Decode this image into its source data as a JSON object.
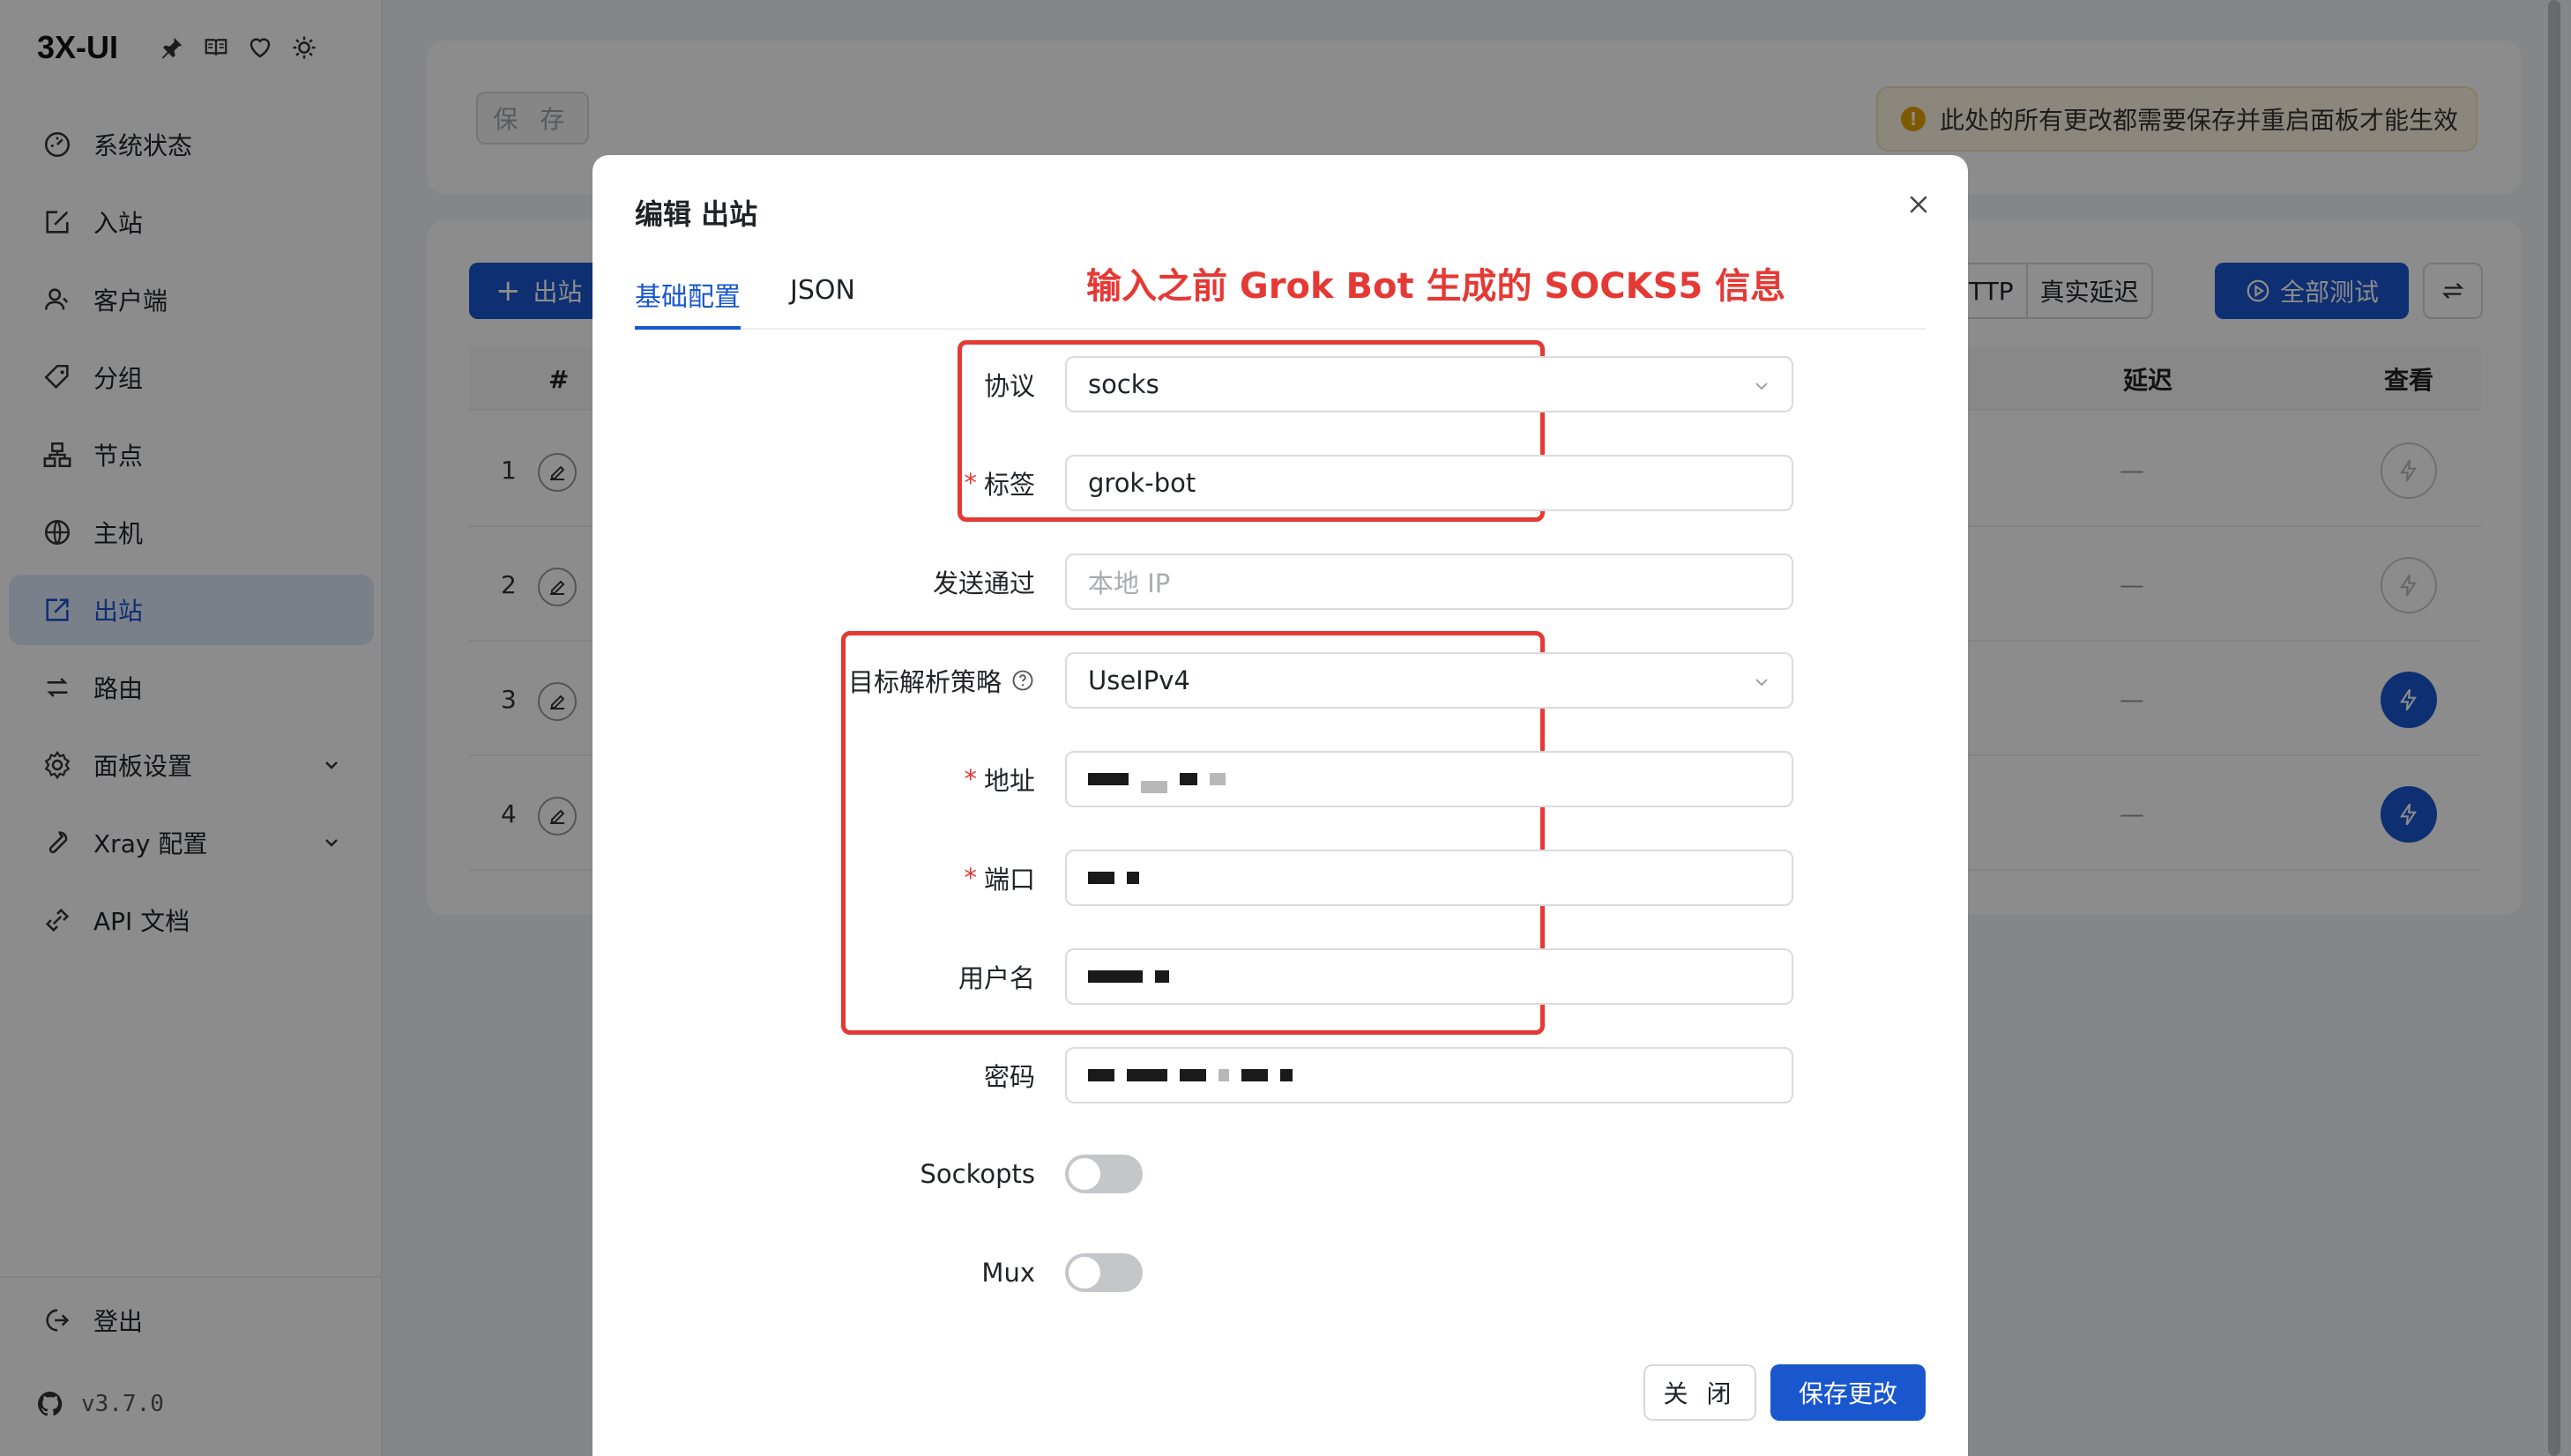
{
  "app": {
    "title": "3X-UI",
    "version": "v3.7.0",
    "accent": "#1a57cf"
  },
  "sidebar": {
    "items": [
      {
        "label": "系统状态",
        "icon": "dashboard-icon"
      },
      {
        "label": "入站",
        "icon": "inbound-icon"
      },
      {
        "label": "客户端",
        "icon": "users-icon"
      },
      {
        "label": "分组",
        "icon": "tag-icon"
      },
      {
        "label": "节点",
        "icon": "nodes-icon"
      },
      {
        "label": "主机",
        "icon": "globe-icon"
      },
      {
        "label": "出站",
        "icon": "outbound-icon",
        "active": true
      },
      {
        "label": "路由",
        "icon": "route-icon"
      },
      {
        "label": "面板设置",
        "icon": "gear-icon",
        "expandable": true
      },
      {
        "label": "Xray 配置",
        "icon": "wrench-icon",
        "expandable": true
      },
      {
        "label": "API 文档",
        "icon": "api-icon"
      }
    ],
    "logout_label": "登出"
  },
  "toolbar": {
    "save_label": "保 存",
    "warning": "此处的所有更改都需要保存并重启面板才能生效"
  },
  "outbounds": {
    "add_label": "出站",
    "test_modes": [
      "HTTP",
      "真实延迟"
    ],
    "test_all_label": "全部测试",
    "columns": [
      "#",
      "延迟",
      "查看"
    ],
    "rows": [
      {
        "index": "1",
        "latency": "—",
        "test_active": false
      },
      {
        "index": "2",
        "latency": "—",
        "test_active": false
      },
      {
        "index": "3",
        "latency": "—",
        "test_active": true
      },
      {
        "index": "4",
        "latency": "—",
        "test_active": true
      }
    ]
  },
  "modal": {
    "title": "编辑 出站",
    "tabs": [
      "基础配置",
      "JSON"
    ],
    "annotation": "输入之前 Grok Bot 生成的 SOCKS5 信息",
    "fields": {
      "protocol": {
        "label": "协议",
        "value": "socks"
      },
      "tag": {
        "label": "标签",
        "value": "grok-bot"
      },
      "send_through": {
        "label": "发送通过",
        "placeholder": "本地 IP"
      },
      "domain_strategy": {
        "label": "目标解析策略",
        "value": "UseIPv4"
      },
      "address": {
        "label": "地址"
      },
      "port": {
        "label": "端口"
      },
      "username": {
        "label": "用户名"
      },
      "password": {
        "label": "密码"
      },
      "sockopts": {
        "label": "Sockopts",
        "enabled": false
      },
      "mux": {
        "label": "Mux",
        "enabled": false
      }
    },
    "close_label": "关 闭",
    "save_label": "保存更改"
  }
}
